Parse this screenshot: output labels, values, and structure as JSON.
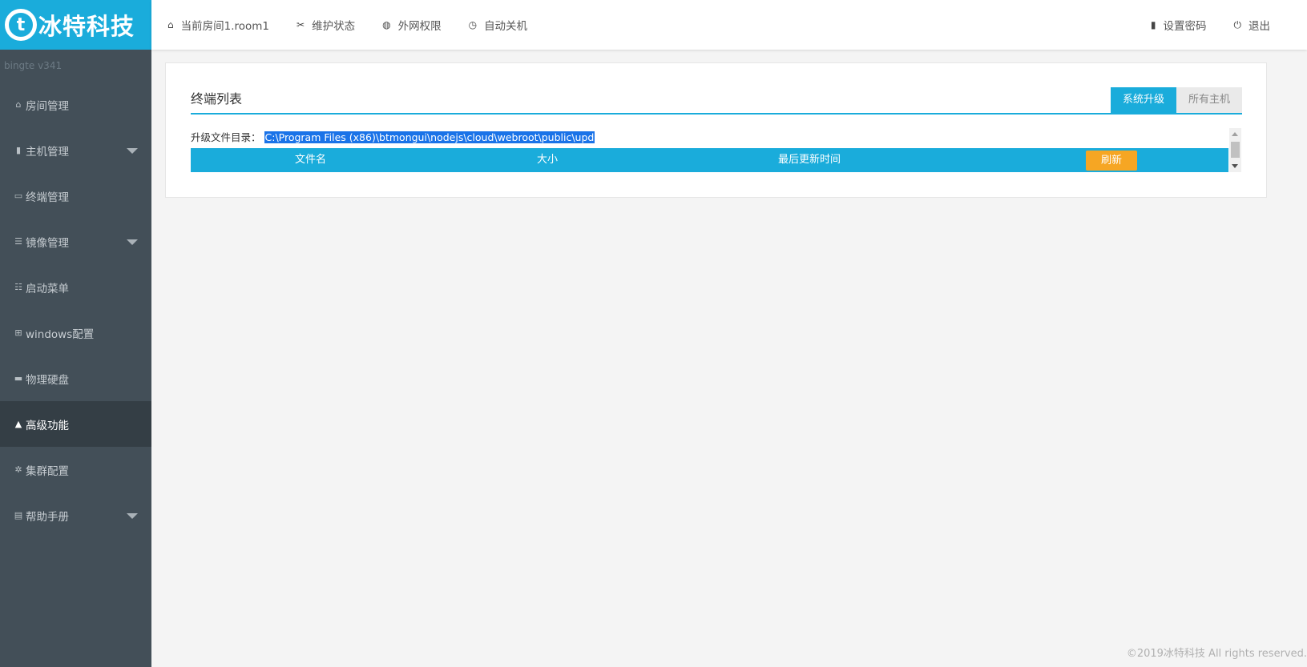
{
  "brand": {
    "logo_mark": "t",
    "name": "冰特科技",
    "version": "bingte v341"
  },
  "sidebar": {
    "items": [
      {
        "label": "房间管理",
        "icon": "home-icon",
        "glyph": "⌂"
      },
      {
        "label": "主机管理",
        "icon": "server-icon",
        "glyph": "▮"
      },
      {
        "label": "终端管理",
        "icon": "monitor-icon",
        "glyph": "▭"
      },
      {
        "label": "镜像管理",
        "icon": "database-icon",
        "glyph": "☰"
      },
      {
        "label": "启动菜单",
        "icon": "list-icon",
        "glyph": "☷"
      },
      {
        "label": "windows配置",
        "icon": "windows-icon",
        "glyph": "⊞"
      },
      {
        "label": "物理硬盘",
        "icon": "hdd-icon",
        "glyph": "▬"
      },
      {
        "label": "高级功能",
        "icon": "warning-icon",
        "glyph": "▲"
      },
      {
        "label": "集群配置",
        "icon": "gear-icon",
        "glyph": "✲"
      },
      {
        "label": "帮助手册",
        "icon": "book-icon",
        "glyph": "▤"
      }
    ],
    "active_label": "高级功能"
  },
  "topbar": {
    "room": {
      "label": "当前房间1.room1",
      "glyph": "⌂"
    },
    "maintenance": {
      "label": "维护状态",
      "glyph": "✂"
    },
    "network": {
      "label": "外网权限",
      "glyph": "◍"
    },
    "shutdown": {
      "label": "自动关机",
      "glyph": "◷"
    },
    "password": {
      "label": "设置密码",
      "glyph": "▮"
    },
    "logout": {
      "label": "退出",
      "glyph": "⏻"
    }
  },
  "panel": {
    "title": "终端列表",
    "tabs": [
      {
        "label": "系统升级"
      },
      {
        "label": "所有主机"
      }
    ],
    "path_label": "升级文件目录：",
    "path_value": "C:\\Program Files (x86)\\btmongui\\nodejs\\cloud\\webroot\\public\\upd",
    "columns": {
      "name": "文件名",
      "size": "大小",
      "updated": "最后更新时间"
    },
    "refresh_label": "刷新"
  },
  "footer": {
    "text": "©2019冰特科技 All rights reserved."
  },
  "colors": {
    "accent": "#1aacdb",
    "sidebar": "#434f58",
    "sidebar_active": "#343e45",
    "refresh": "#f6a623"
  }
}
